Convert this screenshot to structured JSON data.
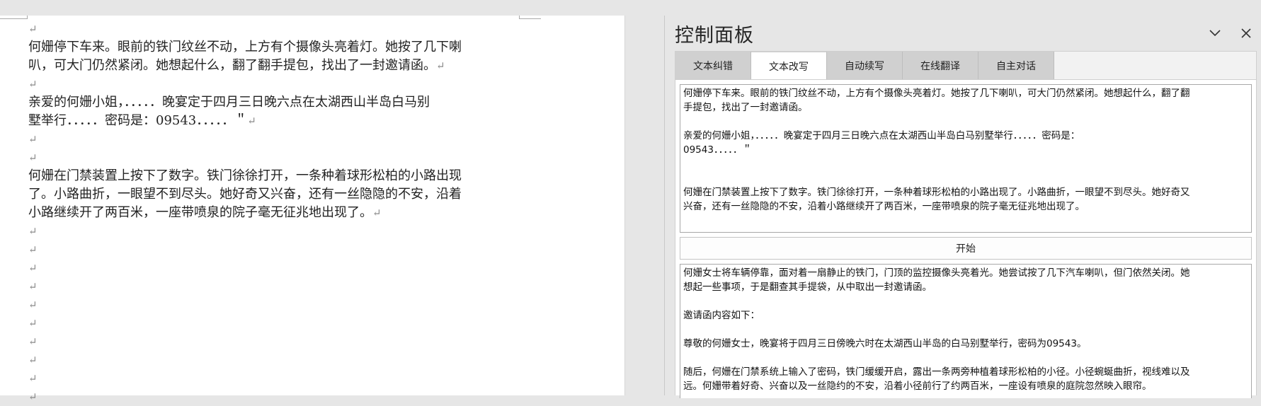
{
  "document": {
    "lines": [
      "",
      "何姗停下车来。眼前的铁门纹丝不动，上方有个摄像头亮着灯。她按了几下喇",
      "叭，可大门仍然紧闭。她想起什么，翻了翻手提包，找出了一封邀请函。",
      "",
      "亲爱的何姗小姐，．．．．．晚宴定于四月三日晚六点在太湖西山半岛白马别",
      "墅举行．．．．．密码是：09543．．．．．＂",
      "",
      "",
      "何姗在门禁装置上按下了数字。铁门徐徐打开，一条种着球形松柏的小路出现",
      "了。小路曲折，一眼望不到尽头。她好奇又兴奋，还有一丝隐隐的不安，沿着",
      "小路继续开了两百米，一座带喷泉的院子毫无征兆地出现了。",
      "",
      "",
      "",
      "",
      "",
      "",
      "",
      "",
      "",
      ""
    ],
    "paragraph_mark": "↵",
    "mark_lines": [
      0,
      2,
      3,
      5,
      6,
      7,
      10,
      11,
      12,
      13,
      14,
      15,
      16,
      17,
      18,
      19,
      20
    ]
  },
  "panel": {
    "title": "控制面板",
    "collapse_icon": "chevron-down-icon",
    "close_icon": "close-icon",
    "tabs": [
      {
        "label": "文本纠错"
      },
      {
        "label": "文本改写"
      },
      {
        "label": "自动续写"
      },
      {
        "label": "在线翻译"
      },
      {
        "label": "自主对话"
      }
    ],
    "active_tab": 1,
    "input_lines": [
      "何姗停下车来。眼前的铁门纹丝不动，上方有个摄像头亮着灯。她按了几下喇叭，可大门仍然紧闭。她想起什么，翻了翻",
      "手提包，找出了一封邀请函。",
      "",
      "亲爱的何姗小姐，．．．．．晚宴定于四月三日晚六点在太湖西山半岛白马别墅举行．．．．．密码是：",
      "09543．．．．．＂",
      "",
      "",
      "何姗在门禁装置上按下了数字。铁门徐徐打开，一条种着球形松柏的小路出现了。小路曲折，一眼望不到尽头。她好奇又",
      "兴奋，还有一丝隐隐的不安，沿着小路继续开了两百米，一座带喷泉的院子毫无征兆地出现了。"
    ],
    "start_label": "开始",
    "output_lines": [
      "何姗女士将车辆停靠，面对着一扇静止的铁门，门顶的监控摄像头亮着光。她尝试按了几下汽车喇叭，但门依然关闭。她",
      "想起一些事项，于是翻查其手提袋，从中取出一封邀请函。",
      "",
      "邀请函内容如下：",
      "",
      "尊敬的何姗女士，晚宴将于四月三日傍晚六时在太湖西山半岛的白马别墅举行，密码为09543。",
      "",
      "随后，何姗在门禁系统上输入了密码，铁门缓缓开启，露出一条两旁种植着球形松柏的小径。小径蜿蜒曲折，视线难以及",
      "远。何姗带着好奇、兴奋以及一丝隐约的不安，沿着小径前行了约两百米，一座设有喷泉的庭院忽然映入眼帘。"
    ]
  },
  "colors": {
    "background": "#e6e6e6",
    "page": "#ffffff",
    "tab_inactive": "#d0d0d0",
    "tab_active": "#ffffff"
  }
}
